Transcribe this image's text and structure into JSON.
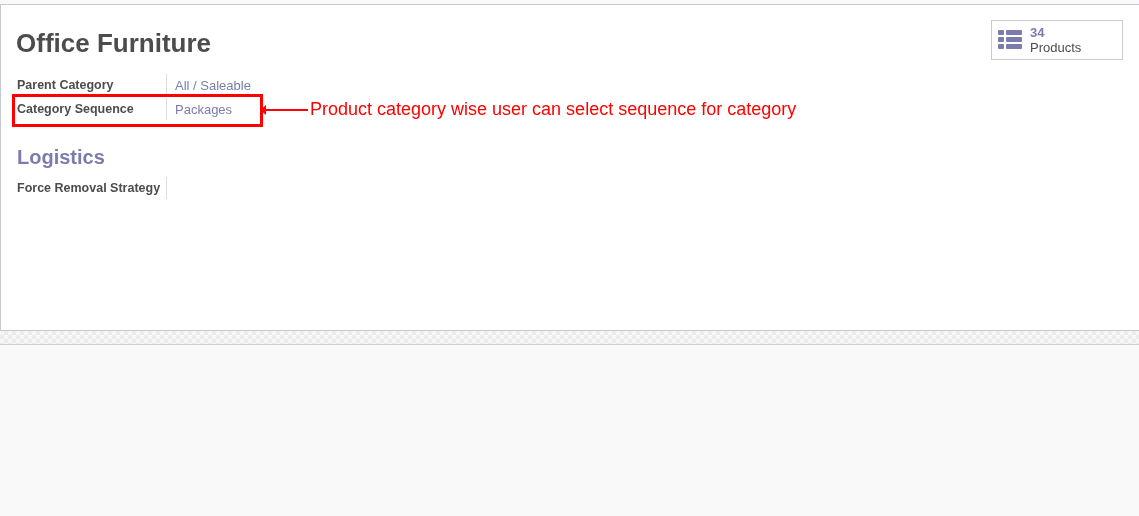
{
  "title": "Office Furniture",
  "stat_button": {
    "count": "34",
    "label": "Products"
  },
  "fields": [
    {
      "label": "Parent Category",
      "value": "All / Saleable",
      "highlighted": false
    },
    {
      "label": "Category Sequence",
      "value": "Packages",
      "highlighted": true
    }
  ],
  "annotation": {
    "text": "Product category wise user can select sequence for category"
  },
  "section": {
    "title": "Logistics",
    "fields": [
      {
        "label": "Force Removal Strategy"
      }
    ]
  }
}
